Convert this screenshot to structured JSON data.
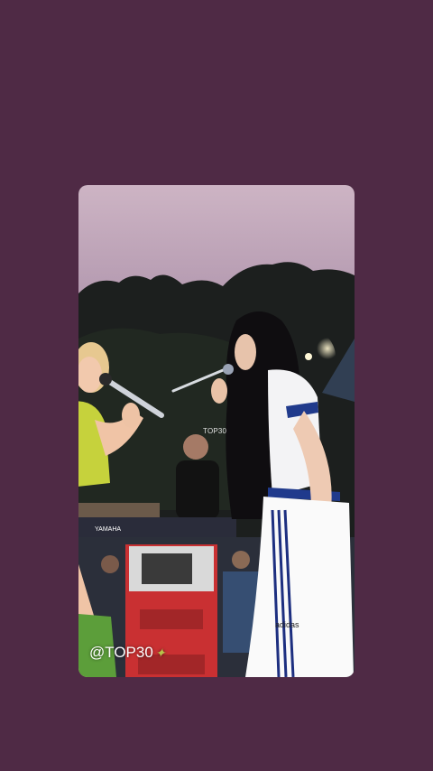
{
  "story": {
    "image_description_icon": "concert-photo",
    "watermark_center": "TOP30",
    "watermark_bottom": "@TOP30",
    "keyboard_brand": "YAMAHA",
    "shorts_logo": "adidas"
  },
  "colors": {
    "background": "#4f2a45",
    "accent_sparkle": "#b7c24a"
  }
}
